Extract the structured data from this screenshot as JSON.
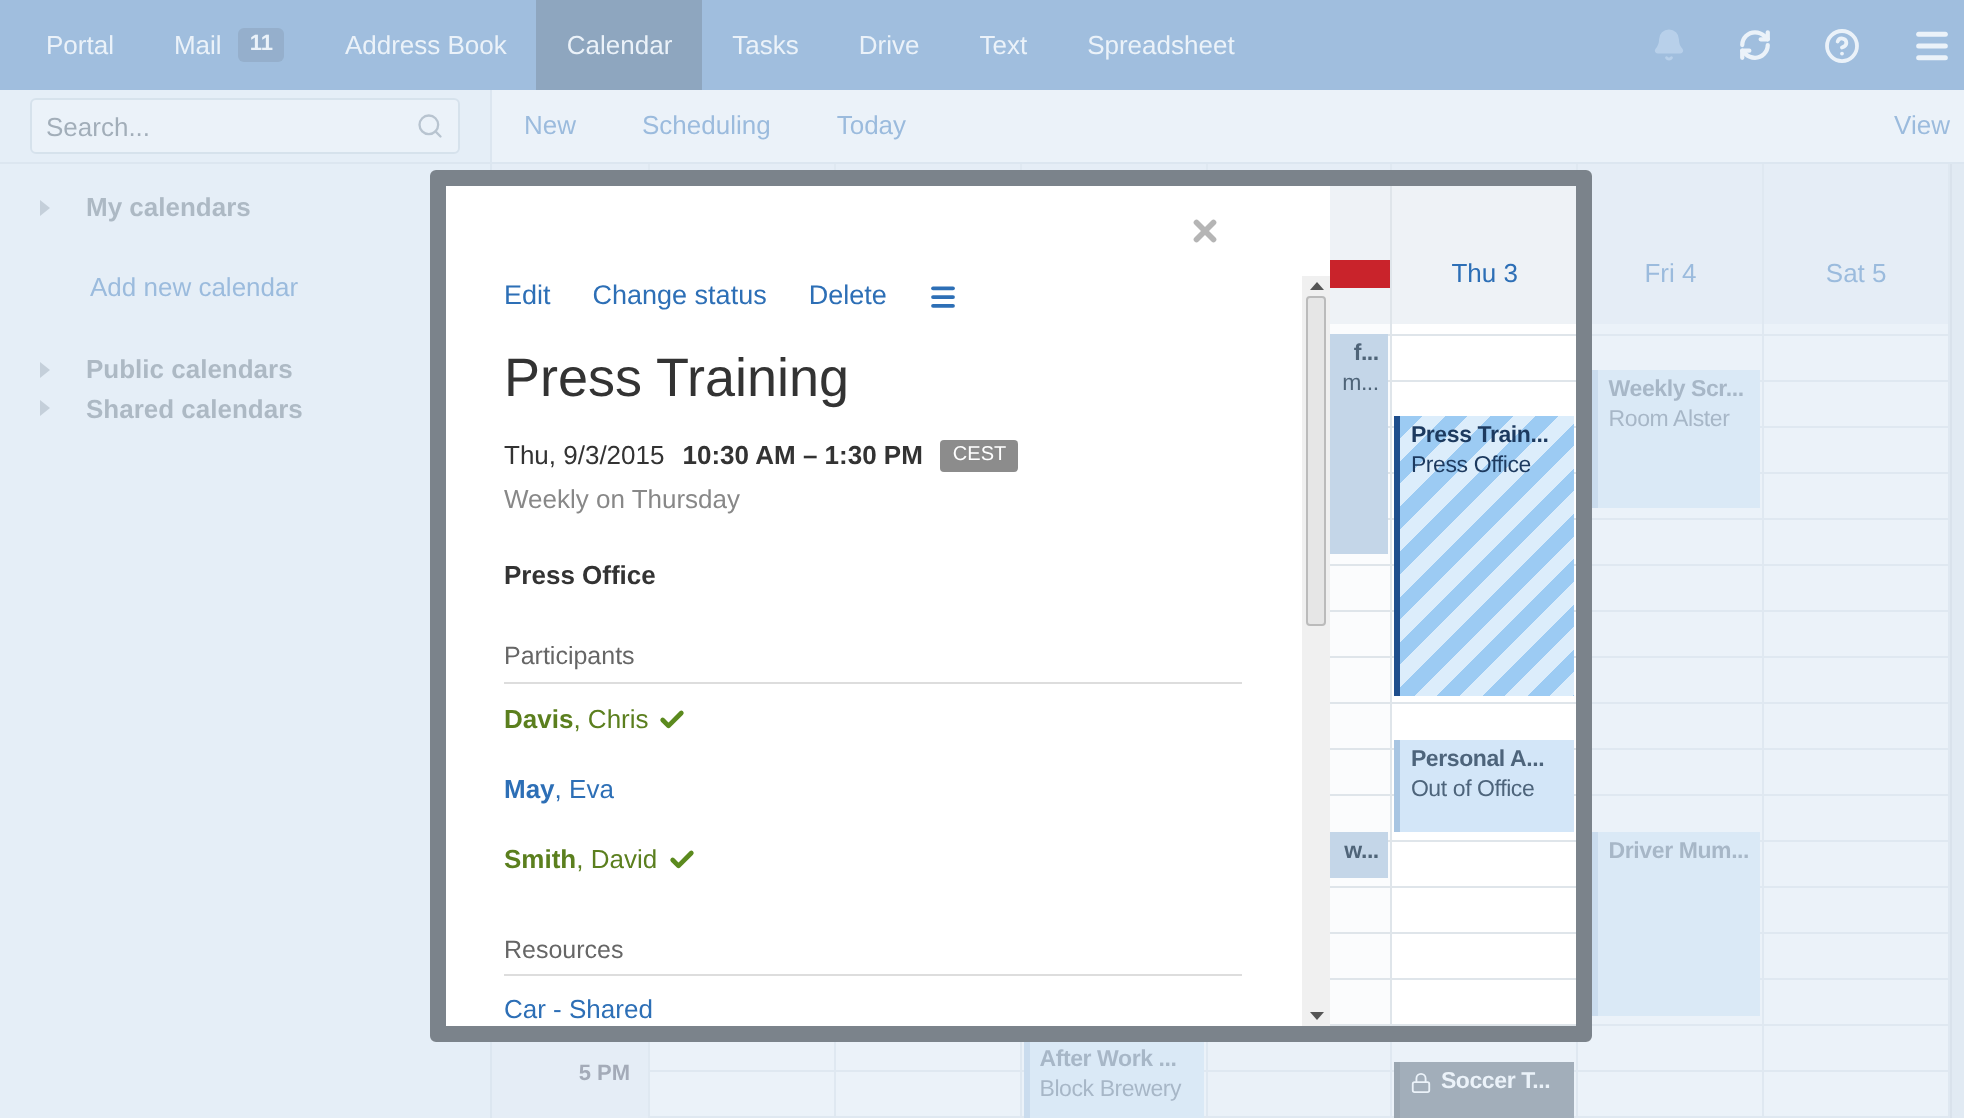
{
  "top_nav": {
    "items": [
      {
        "label": "Portal",
        "selected": false
      },
      {
        "label": "Mail",
        "badge": "11",
        "selected": false
      },
      {
        "label": "Address Book",
        "selected": false
      },
      {
        "label": "Calendar",
        "selected": true
      },
      {
        "label": "Tasks",
        "selected": false
      },
      {
        "label": "Drive",
        "selected": false
      },
      {
        "label": "Text",
        "selected": false
      },
      {
        "label": "Spreadsheet",
        "selected": false
      }
    ]
  },
  "toolbar": {
    "search": {
      "placeholder": "Search..."
    },
    "actions": [
      "New",
      "Scheduling",
      "Today"
    ],
    "view": "View"
  },
  "sidebar": {
    "sections": [
      {
        "label": "My calendars",
        "link": "Add new calendar"
      },
      {
        "label": "Public calendars"
      },
      {
        "label": "Shared calendars"
      }
    ]
  },
  "calendar": {
    "time_labels": [
      "5 PM"
    ],
    "days": [
      {
        "today": false
      },
      {
        "today": false
      },
      {
        "today": false,
        "events": [
          {
            "kind": "normal",
            "title": "After Work ...",
            "location": "Block Brewery"
          }
        ]
      },
      {
        "today": true,
        "events": [
          {
            "kind": "cut",
            "title": "f...",
            "location": "m..."
          },
          {
            "kind": "cut",
            "title": "w..."
          }
        ]
      },
      {
        "label": "Thu 3",
        "today": false,
        "events": [
          {
            "kind": "selected",
            "title": "Press Train...",
            "location": "Press Office"
          },
          {
            "kind": "normal",
            "title": "Personal A...",
            "location": "Out of Office"
          },
          {
            "kind": "private",
            "title": "Soccer T..."
          }
        ]
      },
      {
        "label": "Fri 4",
        "today": false,
        "events": [
          {
            "kind": "normal",
            "title": "Weekly Scr...",
            "location": "Room Alster"
          },
          {
            "kind": "normal",
            "title": "Driver Mum..."
          }
        ]
      },
      {
        "label": "Sat 5",
        "today": false
      }
    ]
  },
  "popup": {
    "actions": [
      "Edit",
      "Change status",
      "Delete"
    ],
    "title": "Press Training",
    "date": "Thu, 9/3/2015",
    "time": "10:30 AM – 1:30 PM",
    "timezone": "CEST",
    "recurrence": "Weekly on Thursday",
    "location": "Press Office",
    "participants_heading": "Participants",
    "participants": [
      {
        "name": "**Davis**, Chris",
        "accepted": true
      },
      {
        "name": "**May**, Eva",
        "accepted": false
      },
      {
        "name": "**Smith**, David",
        "accepted": true
      }
    ],
    "resources_heading": "Resources",
    "resources": [
      "Car - Shared"
    ]
  }
}
